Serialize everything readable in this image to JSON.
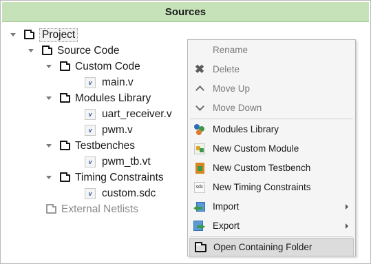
{
  "panel": {
    "title": "Sources"
  },
  "tree": {
    "project": "Project",
    "source_code": "Source Code",
    "custom_code": "Custom Code",
    "main_v": "main.v",
    "modules_library": "Modules Library",
    "uart_receiver_v": "uart_receiver.v",
    "pwm_v": "pwm.v",
    "testbenches": "Testbenches",
    "pwm_tb_vt": "pwm_tb.vt",
    "timing_constraints": "Timing Constraints",
    "custom_sdc": "custom.sdc",
    "external_netlists": "External Netlists"
  },
  "menu": {
    "rename": "Rename",
    "delete": "Delete",
    "move_up": "Move Up",
    "move_down": "Move Down",
    "modules_library": "Modules Library",
    "new_custom_module": "New Custom Module",
    "new_custom_testbench": "New Custom Testbench",
    "new_timing_constraints": "New Timing Constraints",
    "import": "Import",
    "export": "Export",
    "open_containing_folder": "Open Containing Folder"
  },
  "icons": {
    "v_file": "v",
    "sdc_file": "sdc"
  },
  "colors": {
    "header_bg": "#c6e2b8",
    "menu_bg": "#f5f5f5",
    "highlight_bg": "#dcdcdc"
  }
}
